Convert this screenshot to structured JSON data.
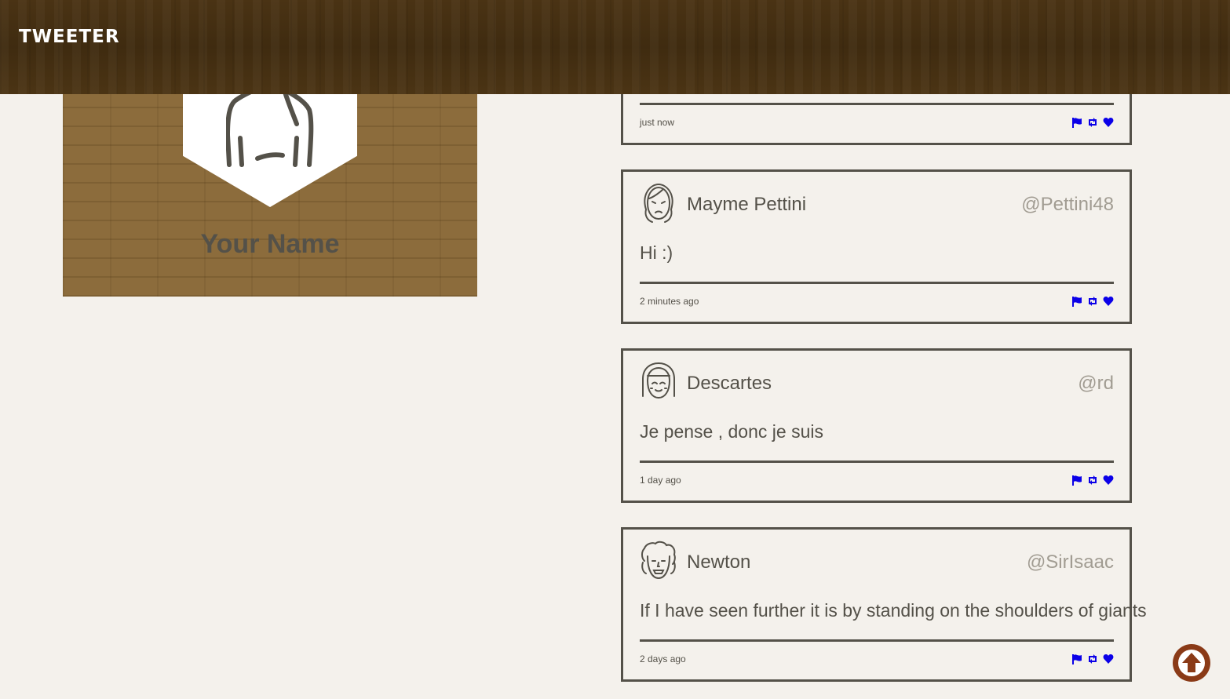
{
  "header": {
    "brand": "TWEETER"
  },
  "profile": {
    "name": "Your Name",
    "icon": "user-silhouette-icon"
  },
  "tweets": [
    {
      "name": "",
      "handle": "",
      "text": "",
      "time": "just now"
    },
    {
      "name": "Mayme Pettini",
      "handle": "@Pettini48",
      "text": "Hi :)",
      "time": "2 minutes ago",
      "avatar": "sad-woman-face-icon"
    },
    {
      "name": "Descartes",
      "handle": "@rd",
      "text": "Je pense , donc je suis",
      "time": "1 day ago",
      "avatar": "girl-face-icon"
    },
    {
      "name": "Newton",
      "handle": "@SirIsaac",
      "text": "If I have seen further it is by standing on the shoulders of giants",
      "time": "2 days ago",
      "avatar": "curly-hair-man-face-icon"
    }
  ],
  "actions": {
    "icons": [
      "flag-icon",
      "retweet-icon",
      "heart-icon"
    ],
    "color": "#0b00e8"
  },
  "colors": {
    "text": "#545149",
    "handle": "#a19c92",
    "background": "#f4f1ec",
    "scroll_button": "#8a3a17"
  },
  "scroll_top_button": {
    "icon": "arrow-up-icon"
  }
}
